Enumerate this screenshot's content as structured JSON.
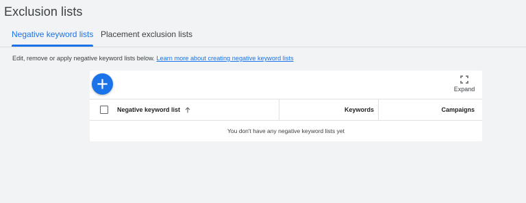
{
  "page": {
    "title": "Exclusion lists"
  },
  "tabs": [
    {
      "label": "Negative keyword lists",
      "active": true
    },
    {
      "label": "Placement exclusion lists",
      "active": false
    }
  ],
  "description": {
    "text": "Edit, remove or apply negative keyword lists below. ",
    "link": "Learn more about creating negative keyword lists"
  },
  "toolbar": {
    "add_icon": "plus-icon",
    "expand_icon": "fullscreen-icon",
    "expand_label": "Expand"
  },
  "table": {
    "columns": {
      "name": "Negative keyword list",
      "keywords": "Keywords",
      "campaigns": "Campaigns"
    },
    "sort": {
      "column": "name",
      "direction": "ascending"
    },
    "rows": [],
    "empty_message": "You don't have any negative keyword lists yet"
  },
  "colors": {
    "accent": "#1a73e8",
    "background": "#f1f3f4",
    "card": "#ffffff"
  }
}
